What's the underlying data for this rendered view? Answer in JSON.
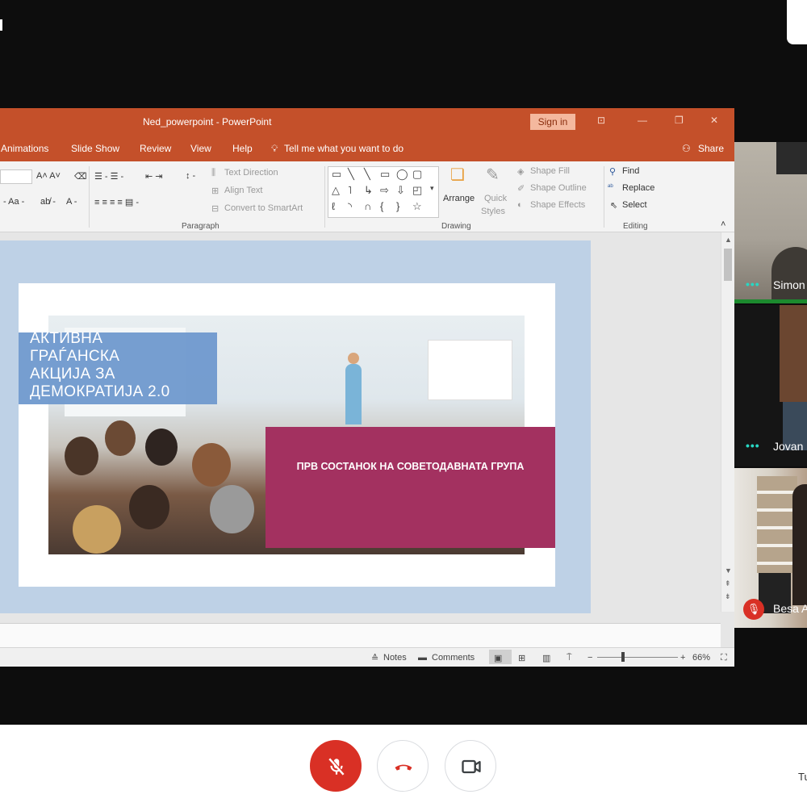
{
  "powerpoint": {
    "window_title": "Ned_powerpoint  -  PowerPoint",
    "sign_in": "Sign in",
    "menu": [
      "Animations",
      "Slide Show",
      "Review",
      "View",
      "Help"
    ],
    "tell_me": "Tell me what you want to do",
    "share": "Share",
    "ribbon": {
      "paragraph": {
        "label": "Paragraph",
        "text_direction": "Text Direction",
        "align_text": "Align Text",
        "convert_smartart": "Convert to SmartArt"
      },
      "drawing": {
        "label": "Drawing",
        "arrange": "Arrange",
        "quick_styles_1": "Quick",
        "quick_styles_2": "Styles",
        "shape_fill": "Shape Fill",
        "shape_outline": "Shape Outline",
        "shape_effects": "Shape Effects"
      },
      "editing": {
        "label": "Editing",
        "find": "Find",
        "replace": "Replace",
        "select": "Select"
      }
    },
    "slide": {
      "title_lines": [
        "АКТИВНА",
        "ГРАЃАНСКА",
        "АКЦИЈА ЗА",
        "ДЕМОКРАТИЈА 2.0"
      ],
      "subtitle": "ПРВ СОСТАНОК НА СОВЕТОДАВНАТА ГРУПА"
    },
    "status": {
      "notes": "Notes",
      "comments": "Comments",
      "zoom": "66%"
    }
  },
  "participants": [
    {
      "name": "Simon",
      "status": "speaking-dots"
    },
    {
      "name": "Jovan",
      "status": "speaking-dots"
    },
    {
      "name": "Besa A",
      "status": "muted"
    }
  ],
  "controls": {
    "mic": "muted",
    "right_cut_text": "Tu"
  },
  "colors": {
    "ppt_accent": "#c4502a",
    "slide_magenta": "#a33160",
    "slide_blue": "#6f99ce",
    "mute_red": "#d93025",
    "speaking_teal": "#28d7c3"
  }
}
